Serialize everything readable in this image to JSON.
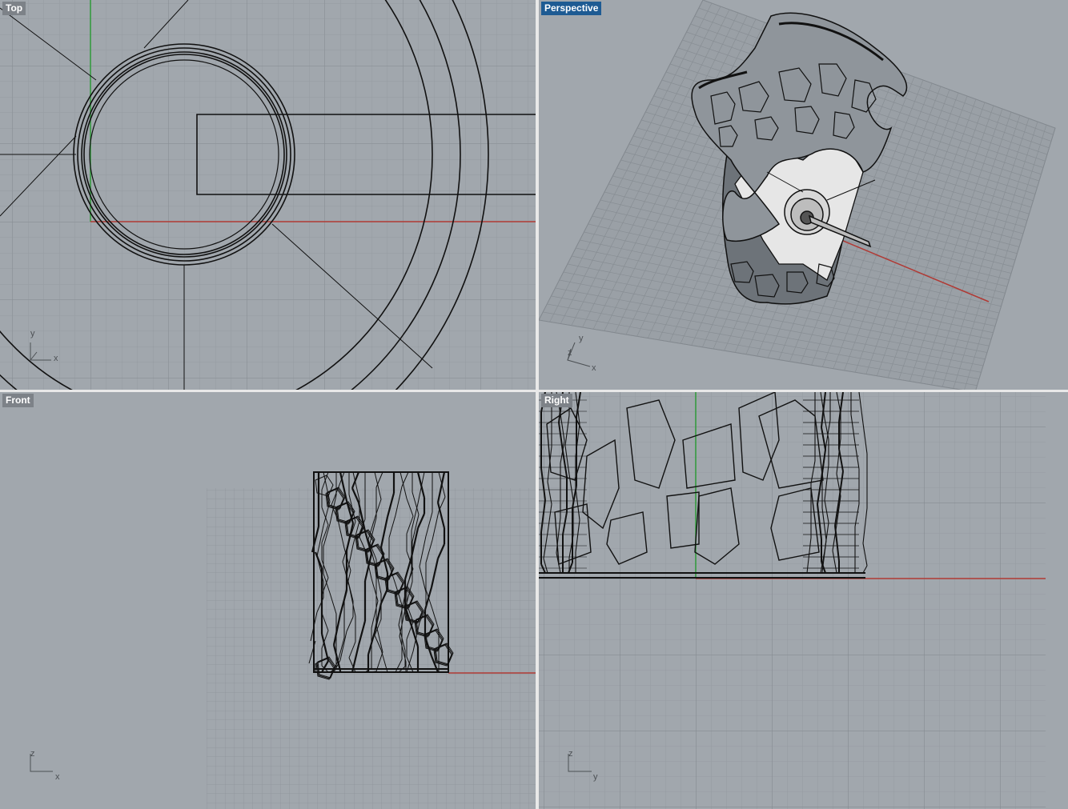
{
  "viewports": {
    "top": {
      "label": "Top",
      "axis_h": "x",
      "axis_v": "y"
    },
    "perspective": {
      "label": "Perspective",
      "axis_h": "x",
      "axis_v": "y",
      "axis_z": "z",
      "active": true
    },
    "front": {
      "label": "Front",
      "axis_h": "x",
      "axis_v": "z"
    },
    "right": {
      "label": "Right",
      "axis_h": "y",
      "axis_v": "z"
    }
  },
  "colors": {
    "viewport_bg": "#a1a7ad",
    "grid_minor": "#959ba1",
    "grid_major": "#7f858b",
    "x_axis": "#b03a35",
    "y_axis": "#2f9a3a",
    "active_label": "#1e5b93",
    "inactive_label": "#7d8288",
    "wire": "#111111"
  },
  "icons": {
    "axis_gizmo": "axis-triad-icon"
  }
}
